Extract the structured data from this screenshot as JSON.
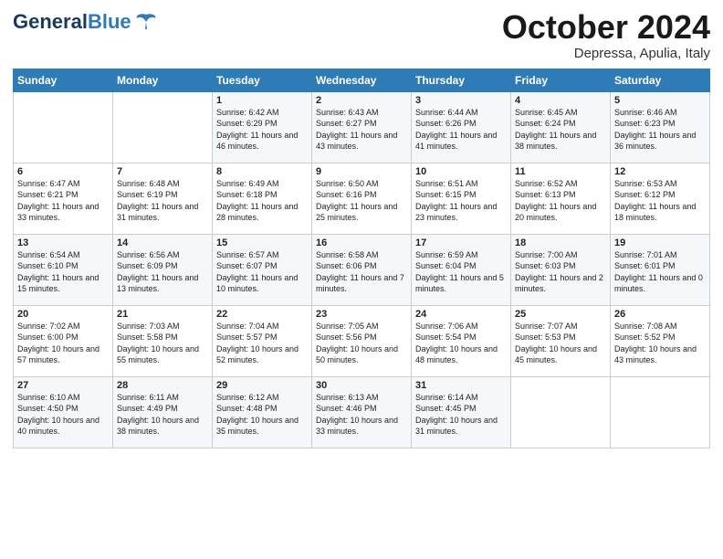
{
  "header": {
    "logo_line1": "General",
    "logo_line2": "Blue",
    "month": "October 2024",
    "location": "Depressa, Apulia, Italy"
  },
  "days_of_week": [
    "Sunday",
    "Monday",
    "Tuesday",
    "Wednesday",
    "Thursday",
    "Friday",
    "Saturday"
  ],
  "weeks": [
    [
      {
        "day": "",
        "sunrise": "",
        "sunset": "",
        "daylight": ""
      },
      {
        "day": "",
        "sunrise": "",
        "sunset": "",
        "daylight": ""
      },
      {
        "day": "1",
        "sunrise": "Sunrise: 6:42 AM",
        "sunset": "Sunset: 6:29 PM",
        "daylight": "Daylight: 11 hours and 46 minutes."
      },
      {
        "day": "2",
        "sunrise": "Sunrise: 6:43 AM",
        "sunset": "Sunset: 6:27 PM",
        "daylight": "Daylight: 11 hours and 43 minutes."
      },
      {
        "day": "3",
        "sunrise": "Sunrise: 6:44 AM",
        "sunset": "Sunset: 6:26 PM",
        "daylight": "Daylight: 11 hours and 41 minutes."
      },
      {
        "day": "4",
        "sunrise": "Sunrise: 6:45 AM",
        "sunset": "Sunset: 6:24 PM",
        "daylight": "Daylight: 11 hours and 38 minutes."
      },
      {
        "day": "5",
        "sunrise": "Sunrise: 6:46 AM",
        "sunset": "Sunset: 6:23 PM",
        "daylight": "Daylight: 11 hours and 36 minutes."
      }
    ],
    [
      {
        "day": "6",
        "sunrise": "Sunrise: 6:47 AM",
        "sunset": "Sunset: 6:21 PM",
        "daylight": "Daylight: 11 hours and 33 minutes."
      },
      {
        "day": "7",
        "sunrise": "Sunrise: 6:48 AM",
        "sunset": "Sunset: 6:19 PM",
        "daylight": "Daylight: 11 hours and 31 minutes."
      },
      {
        "day": "8",
        "sunrise": "Sunrise: 6:49 AM",
        "sunset": "Sunset: 6:18 PM",
        "daylight": "Daylight: 11 hours and 28 minutes."
      },
      {
        "day": "9",
        "sunrise": "Sunrise: 6:50 AM",
        "sunset": "Sunset: 6:16 PM",
        "daylight": "Daylight: 11 hours and 25 minutes."
      },
      {
        "day": "10",
        "sunrise": "Sunrise: 6:51 AM",
        "sunset": "Sunset: 6:15 PM",
        "daylight": "Daylight: 11 hours and 23 minutes."
      },
      {
        "day": "11",
        "sunrise": "Sunrise: 6:52 AM",
        "sunset": "Sunset: 6:13 PM",
        "daylight": "Daylight: 11 hours and 20 minutes."
      },
      {
        "day": "12",
        "sunrise": "Sunrise: 6:53 AM",
        "sunset": "Sunset: 6:12 PM",
        "daylight": "Daylight: 11 hours and 18 minutes."
      }
    ],
    [
      {
        "day": "13",
        "sunrise": "Sunrise: 6:54 AM",
        "sunset": "Sunset: 6:10 PM",
        "daylight": "Daylight: 11 hours and 15 minutes."
      },
      {
        "day": "14",
        "sunrise": "Sunrise: 6:56 AM",
        "sunset": "Sunset: 6:09 PM",
        "daylight": "Daylight: 11 hours and 13 minutes."
      },
      {
        "day": "15",
        "sunrise": "Sunrise: 6:57 AM",
        "sunset": "Sunset: 6:07 PM",
        "daylight": "Daylight: 11 hours and 10 minutes."
      },
      {
        "day": "16",
        "sunrise": "Sunrise: 6:58 AM",
        "sunset": "Sunset: 6:06 PM",
        "daylight": "Daylight: 11 hours and 7 minutes."
      },
      {
        "day": "17",
        "sunrise": "Sunrise: 6:59 AM",
        "sunset": "Sunset: 6:04 PM",
        "daylight": "Daylight: 11 hours and 5 minutes."
      },
      {
        "day": "18",
        "sunrise": "Sunrise: 7:00 AM",
        "sunset": "Sunset: 6:03 PM",
        "daylight": "Daylight: 11 hours and 2 minutes."
      },
      {
        "day": "19",
        "sunrise": "Sunrise: 7:01 AM",
        "sunset": "Sunset: 6:01 PM",
        "daylight": "Daylight: 11 hours and 0 minutes."
      }
    ],
    [
      {
        "day": "20",
        "sunrise": "Sunrise: 7:02 AM",
        "sunset": "Sunset: 6:00 PM",
        "daylight": "Daylight: 10 hours and 57 minutes."
      },
      {
        "day": "21",
        "sunrise": "Sunrise: 7:03 AM",
        "sunset": "Sunset: 5:58 PM",
        "daylight": "Daylight: 10 hours and 55 minutes."
      },
      {
        "day": "22",
        "sunrise": "Sunrise: 7:04 AM",
        "sunset": "Sunset: 5:57 PM",
        "daylight": "Daylight: 10 hours and 52 minutes."
      },
      {
        "day": "23",
        "sunrise": "Sunrise: 7:05 AM",
        "sunset": "Sunset: 5:56 PM",
        "daylight": "Daylight: 10 hours and 50 minutes."
      },
      {
        "day": "24",
        "sunrise": "Sunrise: 7:06 AM",
        "sunset": "Sunset: 5:54 PM",
        "daylight": "Daylight: 10 hours and 48 minutes."
      },
      {
        "day": "25",
        "sunrise": "Sunrise: 7:07 AM",
        "sunset": "Sunset: 5:53 PM",
        "daylight": "Daylight: 10 hours and 45 minutes."
      },
      {
        "day": "26",
        "sunrise": "Sunrise: 7:08 AM",
        "sunset": "Sunset: 5:52 PM",
        "daylight": "Daylight: 10 hours and 43 minutes."
      }
    ],
    [
      {
        "day": "27",
        "sunrise": "Sunrise: 6:10 AM",
        "sunset": "Sunset: 4:50 PM",
        "daylight": "Daylight: 10 hours and 40 minutes."
      },
      {
        "day": "28",
        "sunrise": "Sunrise: 6:11 AM",
        "sunset": "Sunset: 4:49 PM",
        "daylight": "Daylight: 10 hours and 38 minutes."
      },
      {
        "day": "29",
        "sunrise": "Sunrise: 6:12 AM",
        "sunset": "Sunset: 4:48 PM",
        "daylight": "Daylight: 10 hours and 35 minutes."
      },
      {
        "day": "30",
        "sunrise": "Sunrise: 6:13 AM",
        "sunset": "Sunset: 4:46 PM",
        "daylight": "Daylight: 10 hours and 33 minutes."
      },
      {
        "day": "31",
        "sunrise": "Sunrise: 6:14 AM",
        "sunset": "Sunset: 4:45 PM",
        "daylight": "Daylight: 10 hours and 31 minutes."
      },
      {
        "day": "",
        "sunrise": "",
        "sunset": "",
        "daylight": ""
      },
      {
        "day": "",
        "sunrise": "",
        "sunset": "",
        "daylight": ""
      }
    ]
  ]
}
